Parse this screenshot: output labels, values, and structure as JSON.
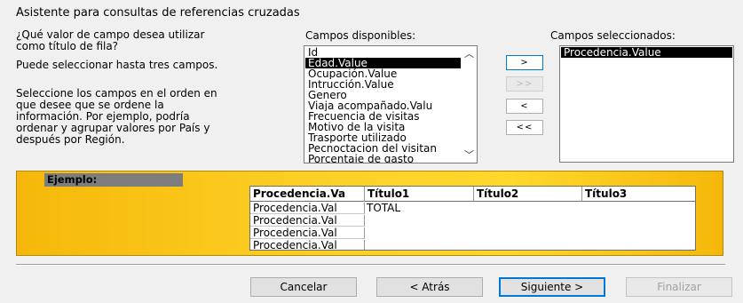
{
  "dialog": {
    "title": "Asistente para consultas de referencias cruzadas"
  },
  "instructions": {
    "question": "¿Qué valor de campo desea utilizar\ncomo título de fila?",
    "limit": "Puede seleccionar hasta tres campos.",
    "order": "Seleccione los campos en el orden en\nque desee que se ordene la\ninformación. Por ejemplo, podría\nordenar y agrupar valores por País y\ndespués por Región."
  },
  "available": {
    "label": "Campos disponibles:",
    "items": [
      "Id",
      "Edad.Value",
      "Ocupación.Value",
      "Intrucción.Value",
      "Genero",
      "Viaja acompañado.Valu",
      "Frecuencia de visitas",
      "Motivo de la visita",
      "Trasporte utilizado",
      "Pecnoctacion del visitan",
      "Porcentaje de gasto"
    ],
    "selected": "Edad.Value"
  },
  "move_buttons": {
    "add_one": ">",
    "add_all": ">>",
    "remove_one": "<",
    "remove_all": "<<"
  },
  "selected_fields": {
    "label": "Campos seleccionados:",
    "items": [
      "Procedencia.Value"
    ]
  },
  "example": {
    "label": "Ejemplo:",
    "row_header": "Procedencia.Va",
    "columns": [
      "Título1",
      "Título2",
      "Título3"
    ],
    "rows": [
      "Procedencia.Val",
      "Procedencia.Val",
      "Procedencia.Val",
      "Procedencia.Val"
    ],
    "total": "TOTAL"
  },
  "footer": {
    "cancel": "Cancelar",
    "back": "< Atrás",
    "next": "Siguiente >",
    "finish": "Finalizar"
  },
  "colors": {
    "accent": "#0078d7",
    "example_bg": "#fdd126",
    "selection": "#000000"
  }
}
